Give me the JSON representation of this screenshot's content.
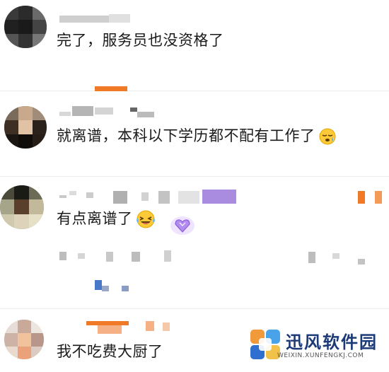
{
  "comments": [
    {
      "text": "完了，服务员也没资格了"
    },
    {
      "text": "就离谱，本科以下学历都不配有工作了"
    },
    {
      "text": "有点离谱了"
    },
    {
      "text": "我不吃费大厨了"
    }
  ],
  "emojis": [
    "sleepy-face-emoji",
    "laughing-tears-emoji",
    "purple-heart-gem-badge"
  ],
  "watermark": {
    "name": "迅风软件园",
    "url": "WEIXIN.XUNFENGKJ.COM"
  },
  "colors": {
    "accent_orange": "#f07a28",
    "badge_purple": "#a98be0",
    "watermark_blue": "#1c3a78"
  }
}
